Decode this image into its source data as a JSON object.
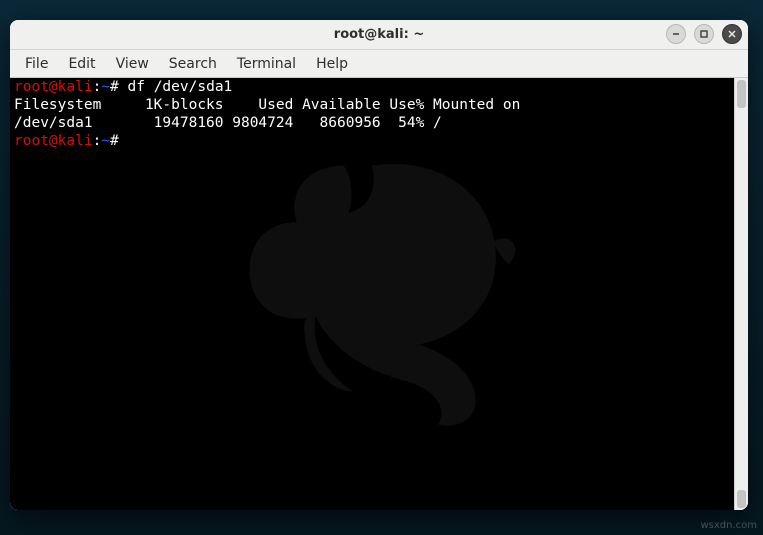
{
  "window": {
    "title": "root@kali: ~"
  },
  "menubar": {
    "items": [
      "File",
      "Edit",
      "View",
      "Search",
      "Terminal",
      "Help"
    ]
  },
  "prompt": {
    "userhost": "root@kali",
    "sep1": ":",
    "path": "~",
    "sep2": "#"
  },
  "terminal": {
    "cmd1": "df /dev/sda1",
    "line2": "Filesystem     1K-blocks    Used Available Use% Mounted on",
    "line3": "/dev/sda1       19478160 9804724   8660956  54% /"
  },
  "watermark": "wsxdn.com"
}
